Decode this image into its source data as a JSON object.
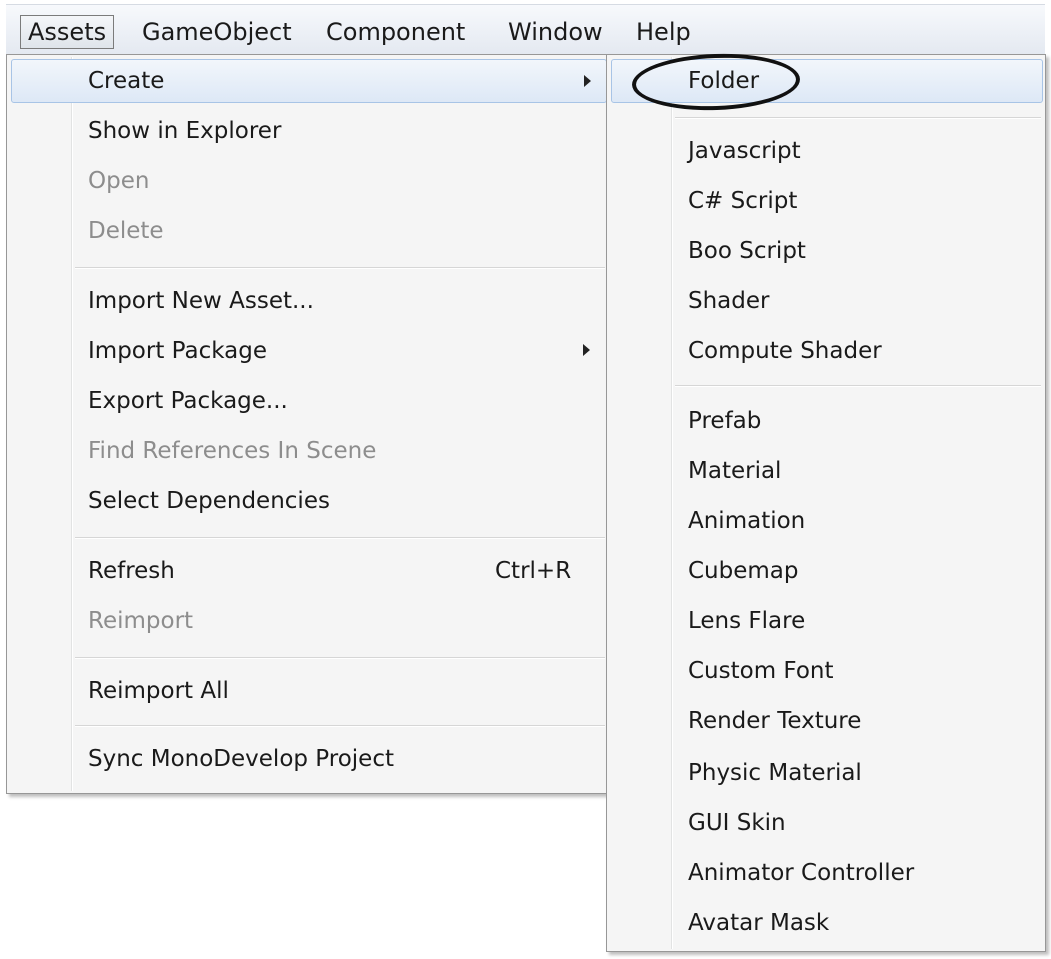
{
  "menubar": {
    "items": [
      {
        "label": "Assets"
      },
      {
        "label": "GameObject"
      },
      {
        "label": "Component"
      },
      {
        "label": "Window"
      },
      {
        "label": "Help"
      }
    ]
  },
  "assets_menu": {
    "items": [
      {
        "label": "Create"
      },
      {
        "label": "Show in Explorer"
      },
      {
        "label": "Open"
      },
      {
        "label": "Delete"
      },
      {
        "label": "Import New Asset..."
      },
      {
        "label": "Import Package"
      },
      {
        "label": "Export Package..."
      },
      {
        "label": "Find References In Scene"
      },
      {
        "label": "Select Dependencies"
      },
      {
        "label": "Refresh",
        "shortcut": "Ctrl+R"
      },
      {
        "label": "Reimport"
      },
      {
        "label": "Reimport All"
      },
      {
        "label": "Sync MonoDevelop Project"
      }
    ]
  },
  "create_submenu": {
    "items": [
      {
        "label": "Folder"
      },
      {
        "label": "Javascript"
      },
      {
        "label": "C# Script"
      },
      {
        "label": "Boo Script"
      },
      {
        "label": "Shader"
      },
      {
        "label": "Compute Shader"
      },
      {
        "label": "Prefab"
      },
      {
        "label": "Material"
      },
      {
        "label": "Animation"
      },
      {
        "label": "Cubemap"
      },
      {
        "label": "Lens Flare"
      },
      {
        "label": "Custom Font"
      },
      {
        "label": "Render Texture"
      },
      {
        "label": "Physic Material"
      },
      {
        "label": "GUI Skin"
      },
      {
        "label": "Animator Controller"
      },
      {
        "label": "Avatar Mask"
      }
    ]
  },
  "colors": {
    "hover_border": "#a8c4e6",
    "disabled_text": "#8d8d8d",
    "annotation": "#111111"
  }
}
